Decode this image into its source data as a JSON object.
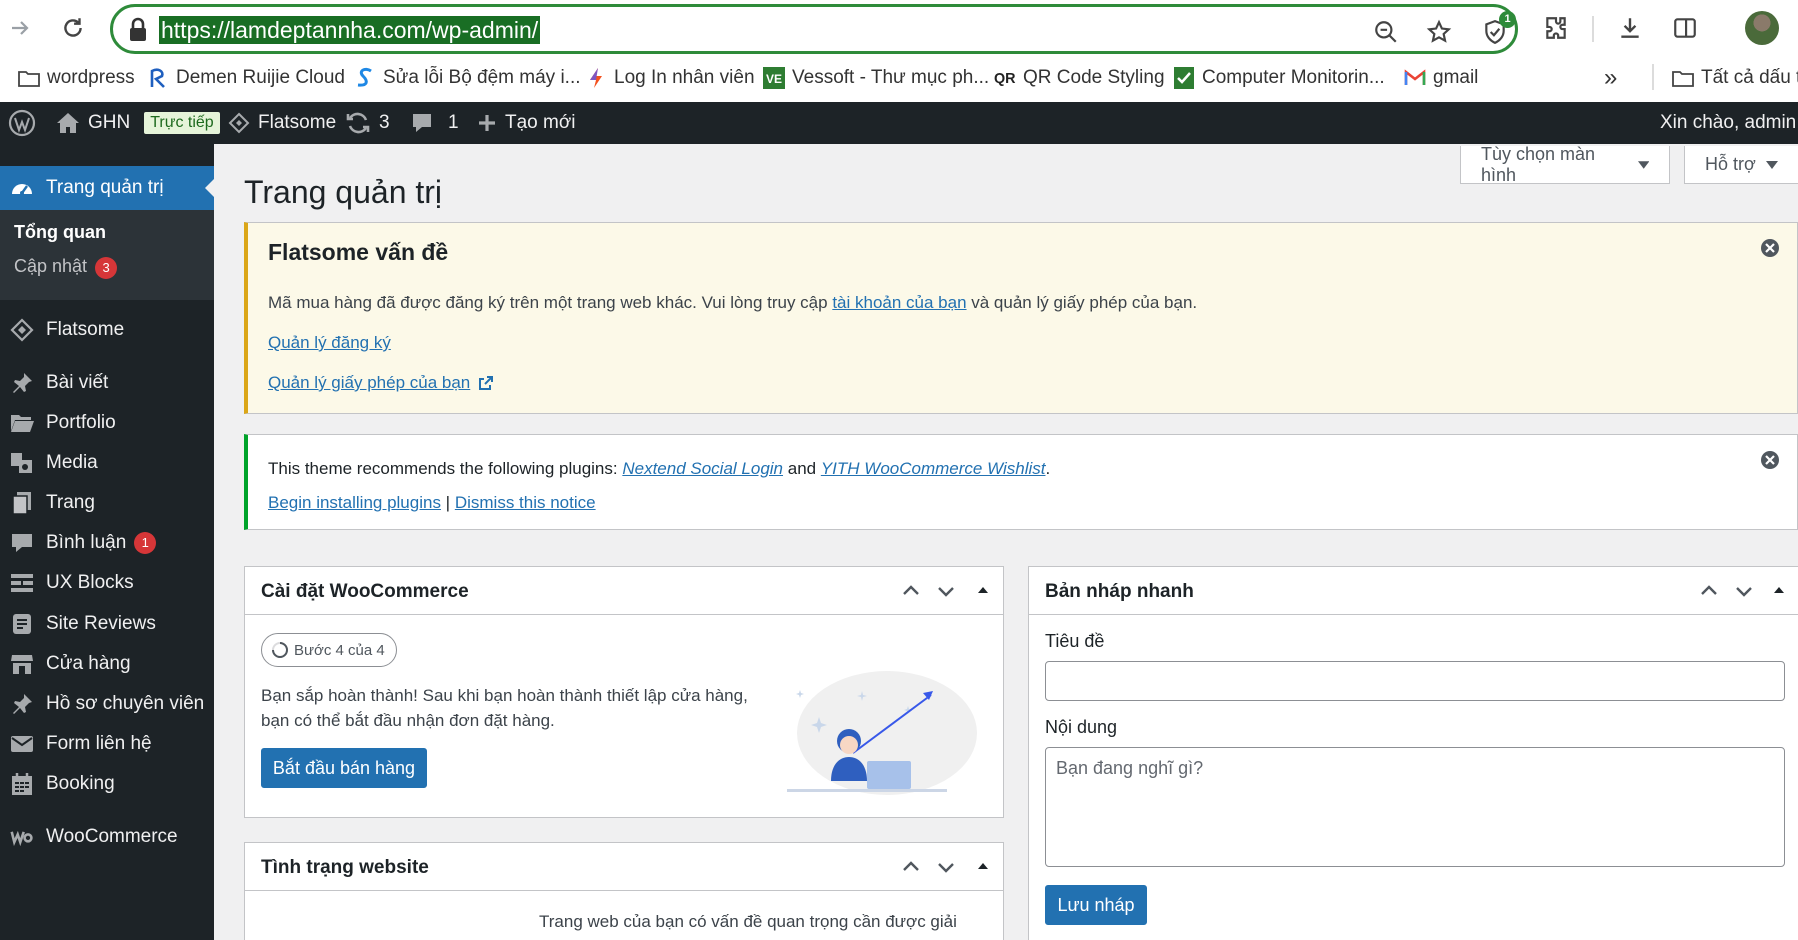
{
  "browser": {
    "url": "https://lamdeptannha.com/wp-admin/",
    "extension_badge": "1",
    "bookmarks": [
      {
        "label": "wordpress",
        "icon": "folder-icon"
      },
      {
        "label": "Demen Ruijie Cloud",
        "icon": "ruijie-icon"
      },
      {
        "label": "Sửa lỗi Bộ đệm máy i...",
        "icon": "s-logo-icon"
      },
      {
        "label": "Log In nhân viên",
        "icon": "bolt-icon"
      },
      {
        "label": "Vessoft - Thư mục ph...",
        "icon": "ve-icon"
      },
      {
        "label": "QR Code Styling",
        "icon": "qr-icon"
      },
      {
        "label": "Computer Monitorin...",
        "icon": "check-icon"
      },
      {
        "label": "gmail",
        "icon": "gmail-icon"
      }
    ],
    "overflow": "»",
    "all_bookmarks": "Tất cả dấu tr"
  },
  "adminbar": {
    "site": "GHN",
    "live": "Trực tiếp",
    "theme": "Flatsome",
    "updates": "3",
    "comments": "1",
    "new": "Tạo mới",
    "greeting": "Xin chào, admin"
  },
  "sidebar": {
    "current": "Trang quản trị",
    "sub": {
      "overview": "Tổng quan",
      "updates": "Cập nhật",
      "updates_count": "3"
    },
    "items": [
      {
        "label": "Flatsome",
        "icon": "flatsome-icon"
      },
      {
        "label": "Bài viết",
        "icon": "pin-icon"
      },
      {
        "label": "Portfolio",
        "icon": "folder-open-icon"
      },
      {
        "label": "Media",
        "icon": "media-icon"
      },
      {
        "label": "Trang",
        "icon": "pages-icon"
      },
      {
        "label": "Bình luận",
        "icon": "comment-icon",
        "count": "1"
      },
      {
        "label": "UX Blocks",
        "icon": "blocks-icon"
      },
      {
        "label": "Site Reviews",
        "icon": "reviews-icon"
      },
      {
        "label": "Cửa hàng",
        "icon": "store-icon"
      },
      {
        "label": "Hồ sơ chuyên viên",
        "icon": "pin-icon"
      },
      {
        "label": "Form liên hệ",
        "icon": "mail-icon"
      },
      {
        "label": "Booking",
        "icon": "calendar-icon"
      },
      {
        "label": "WooCommerce",
        "icon": "woo-icon"
      }
    ]
  },
  "main": {
    "screen_options": "Tùy chọn màn hình",
    "help": "Hỗ trợ",
    "title": "Trang quản trị",
    "flatsome_notice": {
      "title": "Flatsome vấn đề",
      "text_before": "Mã mua hàng đã được đăng ký trên một trang web khác. Vui lòng truy cập ",
      "link": "tài khoản của bạn",
      "text_after": " và quản lý giấy phép của bạn.",
      "manage_reg": "Quản lý đăng ký",
      "manage_license": "Quản lý giấy phép của bạn"
    },
    "plugin_notice": {
      "text": "This theme recommends the following plugins: ",
      "plugin1": "Nextend Social Login",
      "and": " and ",
      "plugin2": "YITH WooCommerce Wishlist",
      "dot": ".",
      "begin": "Begin installing plugins",
      "sep": " | ",
      "dismiss": "Dismiss this notice"
    },
    "woo_setup": {
      "title": "Cài đặt WooCommerce",
      "step": "Bước 4 của 4",
      "text1": "Bạn sắp hoàn thành! Sau khi bạn hoàn thành thiết lập cửa hàng,",
      "text2": "bạn có thể bắt đầu nhận đơn đặt hàng.",
      "button": "Bắt đầu bán hàng"
    },
    "site_health": {
      "title": "Tình trạng website",
      "text": "Trang web của bạn có vấn đề quan trọng cần được giải"
    },
    "quick_draft": {
      "title": "Bản nháp nhanh",
      "title_label": "Tiêu đề",
      "content_label": "Nội dung",
      "content_placeholder": "Bạn đang nghĩ gì?",
      "save": "Lưu nháp"
    }
  },
  "colors": {
    "admin_bg": "#1d2327",
    "accent": "#2271b1",
    "warning": "#dba617",
    "success": "#00a32a",
    "badge": "#d63638",
    "omnibox_border": "#2e8b3a"
  }
}
